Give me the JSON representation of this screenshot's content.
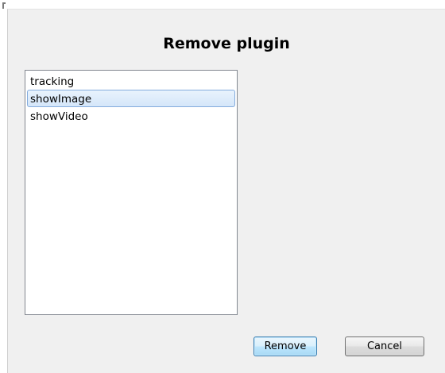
{
  "dialog": {
    "title": "Remove plugin"
  },
  "plugin_list": {
    "items": [
      {
        "label": "tracking",
        "selected": false
      },
      {
        "label": "showImage",
        "selected": true
      },
      {
        "label": "showVideo",
        "selected": false
      }
    ]
  },
  "buttons": {
    "remove_label": "Remove",
    "cancel_label": "Cancel"
  },
  "colors": {
    "dialog_bg": "#f0f0f0",
    "selection_border": "#84acdd",
    "default_button_border": "#3c7fb1"
  }
}
